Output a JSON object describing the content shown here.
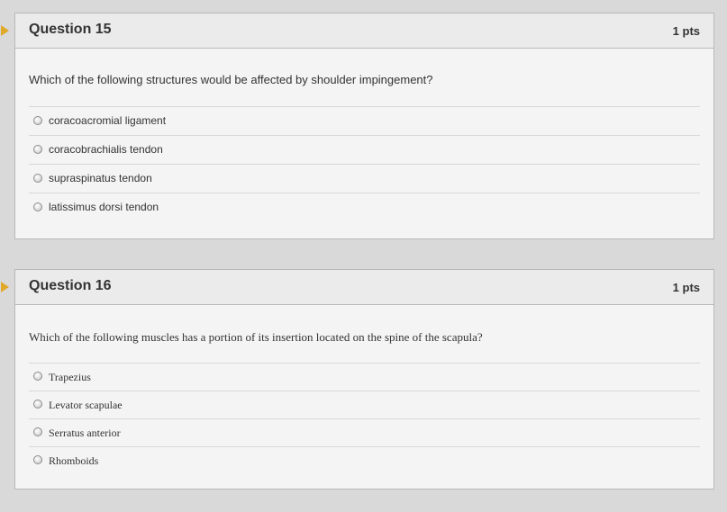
{
  "questions": [
    {
      "title": "Question 15",
      "points": "1 pts",
      "text": "Which of the following structures would be affected by shoulder impingement?",
      "answers": [
        "coracoacromial ligament",
        "coracobrachialis tendon",
        "supraspinatus tendon",
        "latissimus dorsi tendon"
      ]
    },
    {
      "title": "Question 16",
      "points": "1 pts",
      "text": "Which of the following muscles has a portion of its insertion located on the spine of the scapula?",
      "answers": [
        "Trapezius",
        "Levator scapulae",
        "Serratus anterior",
        "Rhomboids"
      ]
    }
  ],
  "colors": {
    "marker": "#e0a92a",
    "header_bg": "#ebebeb",
    "panel_bg": "#f4f4f4"
  }
}
